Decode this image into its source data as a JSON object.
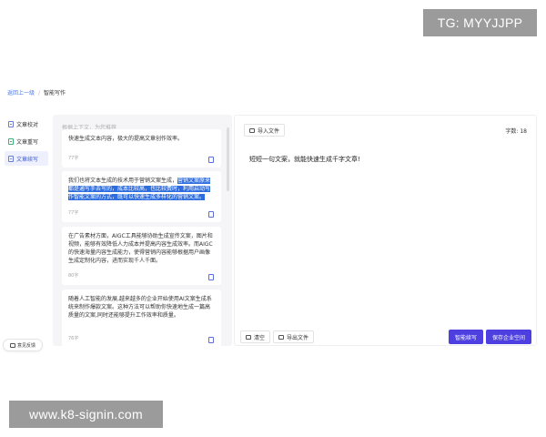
{
  "watermarks": {
    "top": "TG: MYYJJPP",
    "bottom": "www.k8-signin.com"
  },
  "breadcrumb": {
    "back": "返回上一级",
    "current": "智能写作"
  },
  "menu": {
    "items": [
      {
        "label": "文章校对",
        "icon": "doc-check-icon"
      },
      {
        "label": "文章重写",
        "icon": "doc-rewrite-icon"
      },
      {
        "label": "文章续写",
        "icon": "doc-continue-icon"
      }
    ],
    "active_index": 2
  },
  "feedback": {
    "label": "意见反馈"
  },
  "middle": {
    "hint": "根据上下文，为您推荐",
    "cards": [
      {
        "text": "快速生成文本内容，极大的提高文章创作效率。",
        "count": "77字"
      },
      {
        "text_before": "我们也将文本生成的技术用于营销文案生成，",
        "text_highlight": "营销文案原来都是通写手去写的，成本比较高，也比较费时，利用启动写作智能文案的方式，既可以快速生成多样化的营销文案。",
        "count": "77字"
      },
      {
        "text": "在广告素材方面，AIGC工具能够协助生成宣传文案，图片和视频，能够有效降低人力成本并提高内容生成效率。而AIGC的快速海量内容生成能力，使得营销内容能够根据用户画像生成定制化内容，进而实现千人千面。",
        "count": "80字"
      },
      {
        "text": "随着人工智能的发展,越来越多的企业开始使用AI文案生成系统来制作爆款文案。这种方法可以帮助你快速地生成一篇高质量的文案,同时还能够提升工作效率和质量。",
        "count": "76字"
      }
    ]
  },
  "editor": {
    "import_label": "导入文件",
    "word_count": "字数: 18",
    "content": "短短一句文案，就能快速生成千字文章!",
    "clear_label": "清空",
    "export_label": "导出文件",
    "smart_continue_label": "智能续写",
    "save_label": "保存企业空间"
  },
  "colors": {
    "primary": "#4d3fe0",
    "highlight": "#2e6de0",
    "link": "#4a7ae8"
  }
}
